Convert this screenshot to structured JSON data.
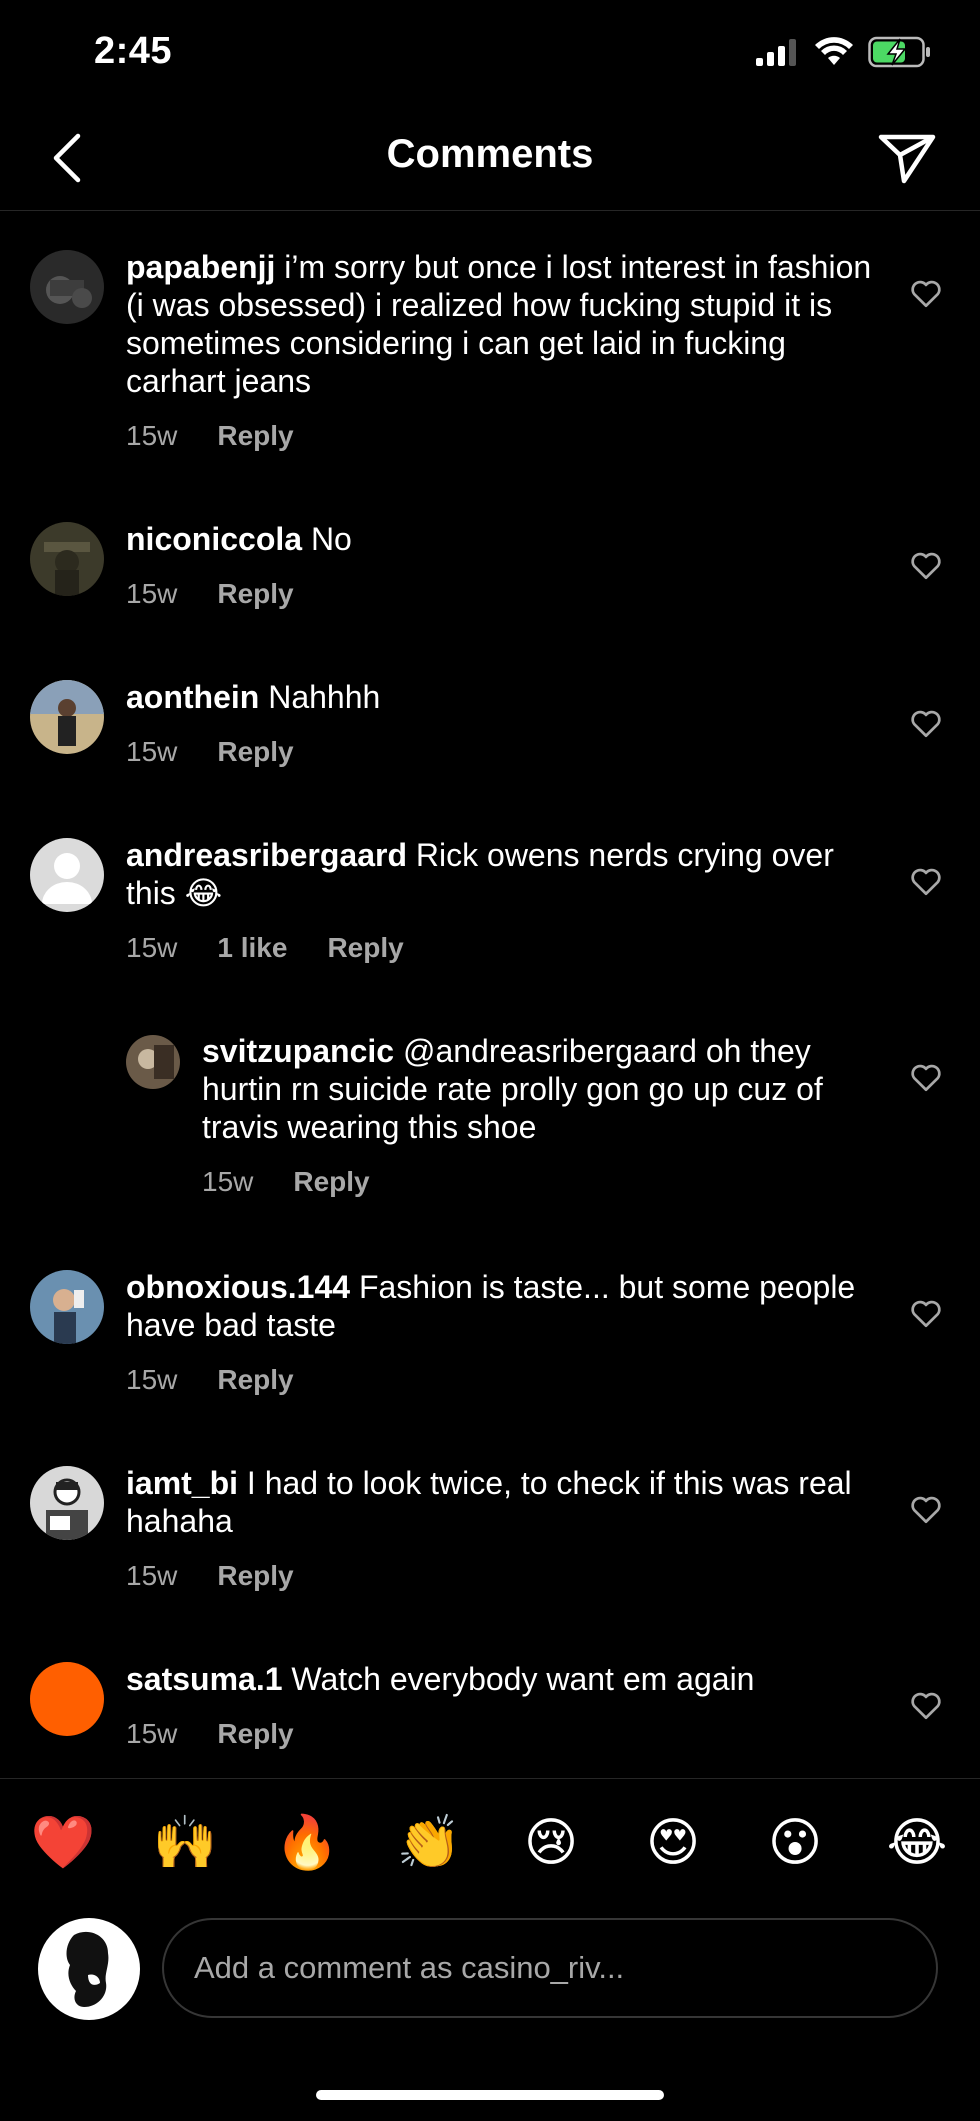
{
  "status_bar": {
    "time": "2:45"
  },
  "header": {
    "title": "Comments"
  },
  "comments": [
    {
      "username": "papabenjj",
      "text": "i’m sorry but once i lost interest in fashion (i was obsessed) i realized how fucking stupid it is sometimes considering i can get laid in fucking carhart jeans",
      "time": "15w",
      "reply": "Reply"
    },
    {
      "username": "niconiccola",
      "text": "No",
      "time": "15w",
      "reply": "Reply"
    },
    {
      "username": "aonthein",
      "text": "Nahhhh",
      "time": "15w",
      "reply": "Reply"
    },
    {
      "username": "andreasribergaard",
      "text": "Rick owens nerds crying over this 😂",
      "time": "15w",
      "likes": "1 like",
      "reply": "Reply"
    },
    {
      "username": "svitzupancic",
      "text": "@andreasribergaard oh they hurtin rn suicide rate prolly gon go up cuz of travis wearing this shoe",
      "time": "15w",
      "reply": "Reply"
    },
    {
      "username": "obnoxious.144",
      "text": "Fashion is taste... but some people have bad taste",
      "time": "15w",
      "reply": "Reply"
    },
    {
      "username": "iamt_bi",
      "text": "I had to look twice, to check if this was real hahaha",
      "time": "15w",
      "reply": "Reply"
    },
    {
      "username": "satsuma.1",
      "text": "Watch everybody want em again",
      "time": "15w",
      "reply": "Reply"
    }
  ],
  "emoji_bar": [
    "❤️",
    "🙌",
    "🔥",
    "👏",
    "😢",
    "😍",
    "😮",
    "😂"
  ],
  "composer": {
    "placeholder": "Add a comment as casino_riv..."
  },
  "colors": {
    "background": "#000000",
    "secondary_text": "#a8a8a8",
    "battery_green": "#4cd964",
    "orange_avatar": "#ff5f00"
  }
}
